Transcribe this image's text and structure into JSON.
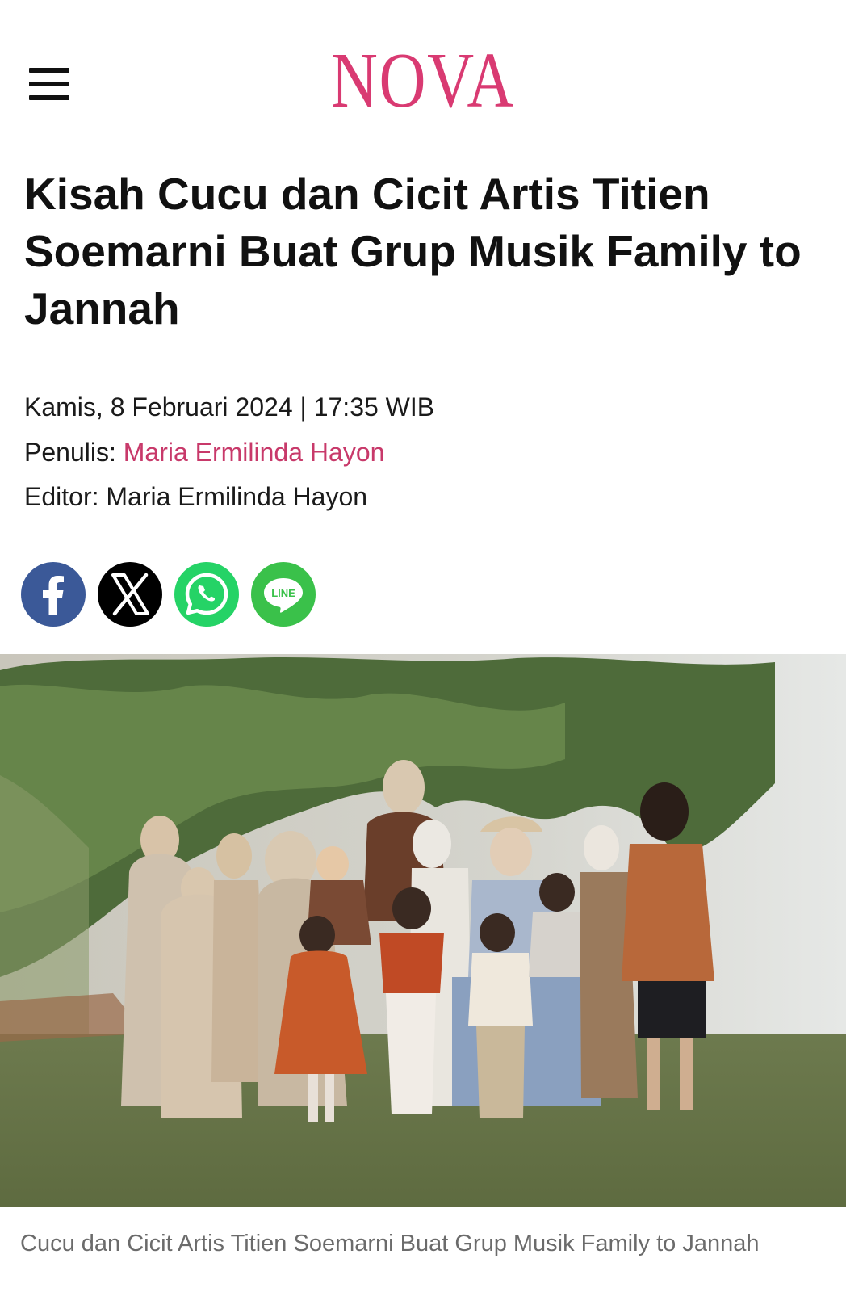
{
  "header": {
    "menu_icon": "hamburger-menu-icon",
    "logo_text": "NOVA",
    "logo_color": "#d93a72"
  },
  "article": {
    "title": "Kisah Cucu dan Cicit Artis Titien Soemarni Buat Grup Musik Family to Jannah",
    "date": "Kamis, 8 Februari 2024 | 17:35 WIB",
    "writer_label": "Penulis:",
    "writer_name": "Maria Ermilinda Hayon",
    "editor_label": "Editor:",
    "editor_name": "Maria Ermilinda Hayon",
    "accent_color": "#c8396a"
  },
  "share": {
    "buttons": [
      {
        "network": "facebook",
        "icon": "facebook-icon",
        "color": "#3b5998"
      },
      {
        "network": "x",
        "icon": "x-twitter-icon",
        "color": "#000000"
      },
      {
        "network": "whatsapp",
        "icon": "whatsapp-icon",
        "color": "#25d366"
      },
      {
        "network": "line",
        "icon": "line-icon",
        "color": "#3ac14a",
        "label": "LINE"
      }
    ]
  },
  "image": {
    "caption": "Cucu dan Cicit Artis Titien Soemarni Buat Grup Musik Family to Jannah"
  }
}
